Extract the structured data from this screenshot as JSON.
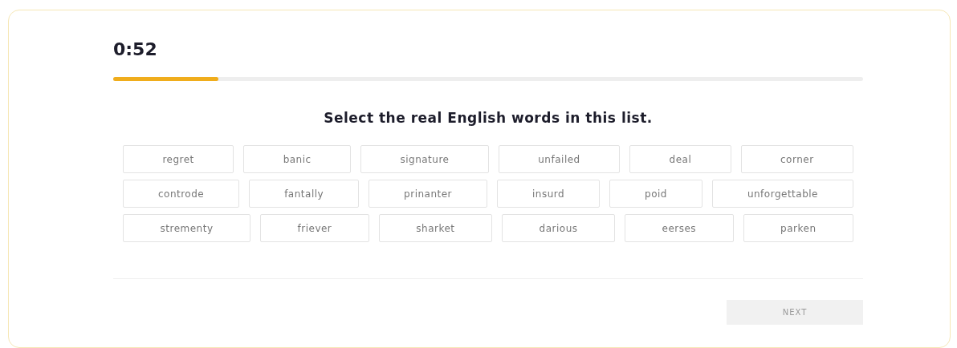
{
  "timer": {
    "text": "0:52",
    "level": 0.14
  },
  "prompt": "Select the real English words in this list.",
  "word_rows": [
    [
      {
        "label": "regret",
        "selected": false
      },
      {
        "label": "banic",
        "selected": false
      },
      {
        "label": "signature",
        "selected": false
      },
      {
        "label": "unfailed",
        "selected": false
      },
      {
        "label": "deal",
        "selected": false
      },
      {
        "label": "corner",
        "selected": false
      }
    ],
    [
      {
        "label": "controde",
        "selected": false
      },
      {
        "label": "fantally",
        "selected": false
      },
      {
        "label": "prinanter",
        "selected": false
      },
      {
        "label": "insurd",
        "selected": false
      },
      {
        "label": "poid",
        "selected": false
      },
      {
        "label": "unforgettable",
        "selected": false
      }
    ],
    [
      {
        "label": "strementy",
        "selected": false
      },
      {
        "label": "friever",
        "selected": false
      },
      {
        "label": "sharket",
        "selected": false
      },
      {
        "label": "darious",
        "selected": false
      },
      {
        "label": "eerses",
        "selected": false
      },
      {
        "label": "parken",
        "selected": false
      }
    ]
  ],
  "next_button": {
    "label": "NEXT",
    "disabled": true
  }
}
